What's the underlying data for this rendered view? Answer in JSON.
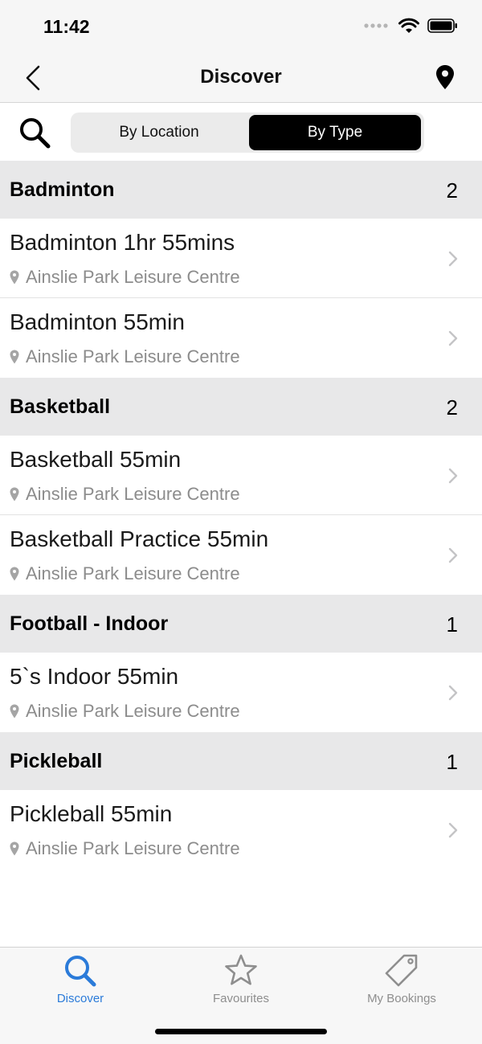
{
  "status_bar": {
    "time": "11:42"
  },
  "nav": {
    "title": "Discover"
  },
  "filter": {
    "segments": [
      "By Location",
      "By Type"
    ],
    "selected": "By Type"
  },
  "sections": [
    {
      "title": "Badminton",
      "count": "2",
      "items": [
        {
          "title": "Badminton 1hr 55mins",
          "location": "Ainslie Park Leisure Centre"
        },
        {
          "title": "Badminton 55min",
          "location": "Ainslie Park Leisure Centre"
        }
      ]
    },
    {
      "title": "Basketball",
      "count": "2",
      "items": [
        {
          "title": "Basketball 55min",
          "location": "Ainslie Park Leisure Centre"
        },
        {
          "title": "Basketball Practice 55min",
          "location": "Ainslie Park Leisure Centre"
        }
      ]
    },
    {
      "title": "Football - Indoor",
      "count": "1",
      "items": [
        {
          "title": "5`s Indoor 55min",
          "location": "Ainslie Park Leisure Centre"
        }
      ]
    },
    {
      "title": "Pickleball",
      "count": "1",
      "items": [
        {
          "title": "Pickleball 55min",
          "location": "Ainslie Park Leisure Centre"
        }
      ]
    }
  ],
  "tabs": [
    {
      "label": "Discover",
      "icon": "search-icon",
      "active": true
    },
    {
      "label": "Favourites",
      "icon": "star-icon",
      "active": false
    },
    {
      "label": "My Bookings",
      "icon": "tag-icon",
      "active": false
    }
  ],
  "colors": {
    "accent": "#2b7bd9",
    "inactive": "#8e8e8e",
    "section_bg": "#e8e8e9"
  }
}
